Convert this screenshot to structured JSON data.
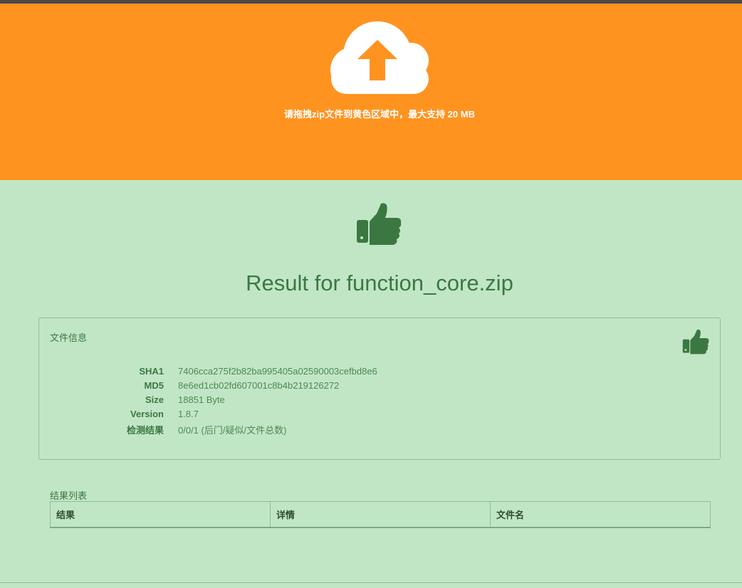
{
  "upload": {
    "icon": "cloud-upload-icon",
    "hint": "请拖拽zip文件到黄色区域中，最大支持 20 MB"
  },
  "result": {
    "icon": "thumbs-up-icon",
    "title": "Result for function_core.zip"
  },
  "file_info": {
    "title": "文件信息",
    "icon": "thumbs-up-icon",
    "rows": [
      {
        "label": "SHA1",
        "value": "7406cca275f2b82ba995405a02590003cefbd8e6"
      },
      {
        "label": "MD5",
        "value": "8e6ed1cb02fd607001c8b4b219126272"
      },
      {
        "label": "Size",
        "value": "18851 Byte"
      },
      {
        "label": "Version",
        "value": "1.8.7"
      },
      {
        "label": "检测结果",
        "value": "0/0/1 (后门/疑似/文件总数)"
      }
    ]
  },
  "result_list": {
    "title": "结果列表",
    "columns": [
      "结果",
      "详情",
      "文件名"
    ]
  },
  "colors": {
    "drop_zone": "#ff9320",
    "result_background": "#c1e6c6",
    "accent_green": "#3b7841"
  }
}
